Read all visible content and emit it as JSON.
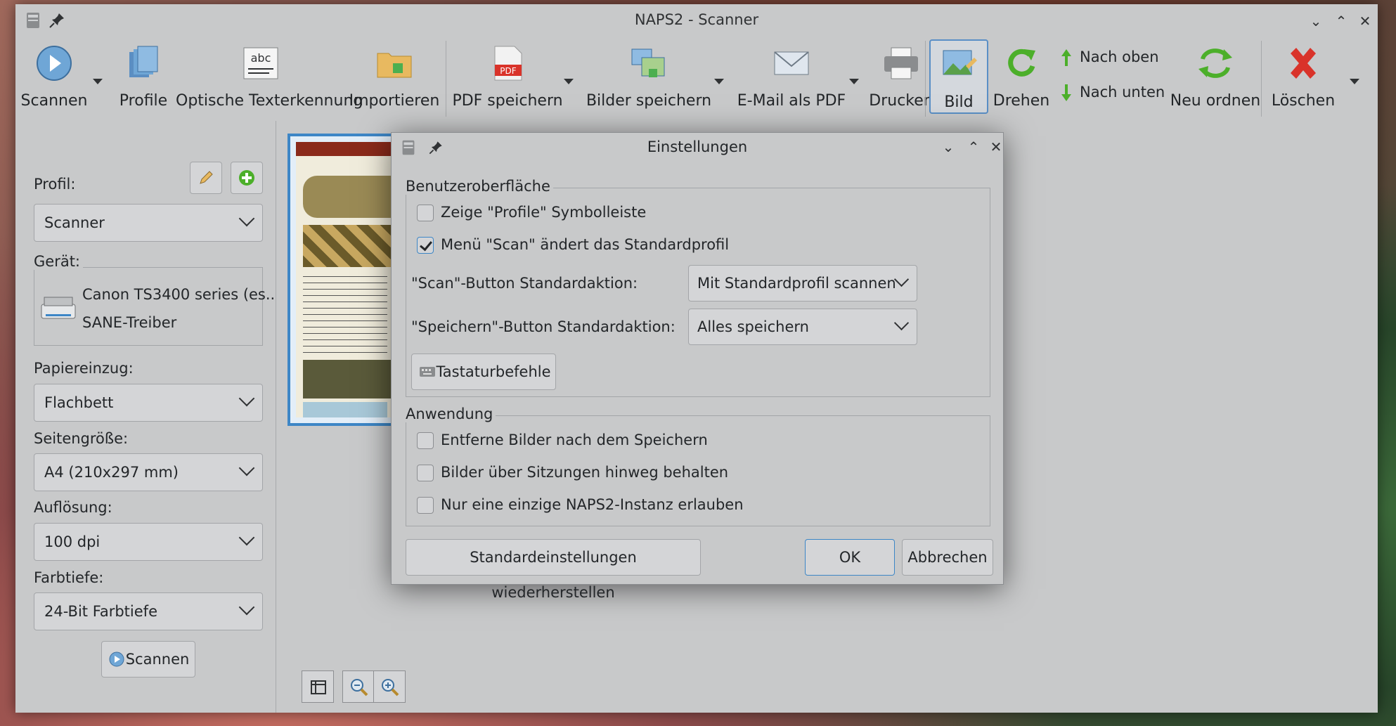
{
  "window": {
    "title": "NAPS2 - Scanner"
  },
  "toolbar": {
    "scan": "Scannen",
    "profiles": "Profile",
    "ocr": "Optische Texterkennung",
    "import": "Importieren",
    "save_pdf": "PDF speichern",
    "save_images": "Bilder speichern",
    "email_pdf": "E-Mail als PDF",
    "print": "Drucken",
    "image": "Bild",
    "rotate": "Drehen",
    "move_up": "Nach oben",
    "move_down": "Nach unten",
    "reorder": "Neu ordnen",
    "delete": "Löschen",
    "ocr_icon_text": "abc",
    "pdf_icon_text": "PDF"
  },
  "sidebar": {
    "profile_label": "Profil:",
    "profile_value": "Scanner",
    "device_label": "Gerät:",
    "device_name": "Canon TS3400 series (es...",
    "device_driver": "SANE-Treiber",
    "paper_source_label": "Papiereinzug:",
    "paper_source_value": "Flachbett",
    "page_size_label": "Seitengröße:",
    "page_size_value": "A4 (210x297 mm)",
    "resolution_label": "Auflösung:",
    "resolution_value": "100 dpi",
    "bit_depth_label": "Farbtiefe:",
    "bit_depth_value": "24-Bit Farbtiefe",
    "scan_button": "Scannen"
  },
  "dialog": {
    "title": "Einstellungen",
    "ui_group": "Benutzeroberfläche",
    "show_profiles_toolbar": "Zeige \"Profile\" Symbolleiste",
    "show_profiles_checked": false,
    "scan_menu_changes_default": "Menü \"Scan\" ändert das Standardprofil",
    "scan_menu_checked": true,
    "scan_button_default_label": "\"Scan\"-Button Standardaktion:",
    "scan_button_default_value": "Mit Standardprofil scannen",
    "save_button_default_label": "\"Speichern\"-Button Standardaktion:",
    "save_button_default_value": "Alles speichern",
    "keyboard_shortcuts": "Tastaturbefehle",
    "app_group": "Anwendung",
    "delete_after_save": "Entferne Bilder nach dem Speichern",
    "keep_images": "Bilder über Sitzungen hinweg behalten",
    "single_instance": "Nur eine einzige NAPS2-Instanz erlauben",
    "restore_defaults": "Standardeinstellungen wiederherstellen",
    "ok": "OK",
    "cancel": "Abbrechen"
  },
  "colors": {
    "accent": "#3d86c6",
    "window_bg": "#c8c9ca",
    "delete_red": "#d9332a",
    "rotate_green": "#4caf2a"
  }
}
